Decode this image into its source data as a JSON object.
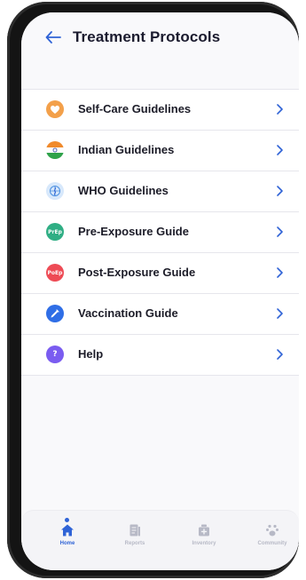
{
  "header": {
    "title": "Treatment Protocols",
    "back_icon": "arrow-left-icon"
  },
  "menu": {
    "items": [
      {
        "label": "Self-Care Guidelines",
        "icon": "heart-icon",
        "color": "#f3a04a"
      },
      {
        "label": "Indian Guidelines",
        "icon": "india-flag-icon",
        "color": "#f08a2c"
      },
      {
        "label": "WHO Guidelines",
        "icon": "who-emblem-icon",
        "color": "#d7e8fb"
      },
      {
        "label": "Pre-Exposure Guide",
        "icon": "prep-badge-icon",
        "badge": "PrEp",
        "color": "#2fae84"
      },
      {
        "label": "Post-Exposure Guide",
        "icon": "poep-badge-icon",
        "badge": "PoEp",
        "color": "#ee4b55"
      },
      {
        "label": "Vaccination Guide",
        "icon": "syringe-icon",
        "color": "#2f6ee6"
      },
      {
        "label": "Help",
        "icon": "question-icon",
        "badge": "?",
        "color": "#7a5cf0"
      }
    ],
    "chevron_icon": "chevron-right-icon"
  },
  "tabbar": {
    "tabs": [
      {
        "label": "Home",
        "icon": "home-icon",
        "active": true
      },
      {
        "label": "Reports",
        "icon": "reports-icon",
        "active": false
      },
      {
        "label": "Inventory",
        "icon": "inventory-icon",
        "active": false
      },
      {
        "label": "Community",
        "icon": "community-icon",
        "active": false
      }
    ]
  },
  "colors": {
    "accent": "#2f63d6",
    "chevron": "#2f63d6",
    "text": "#1c1c28",
    "tab_inactive": "#b7b9c6"
  }
}
